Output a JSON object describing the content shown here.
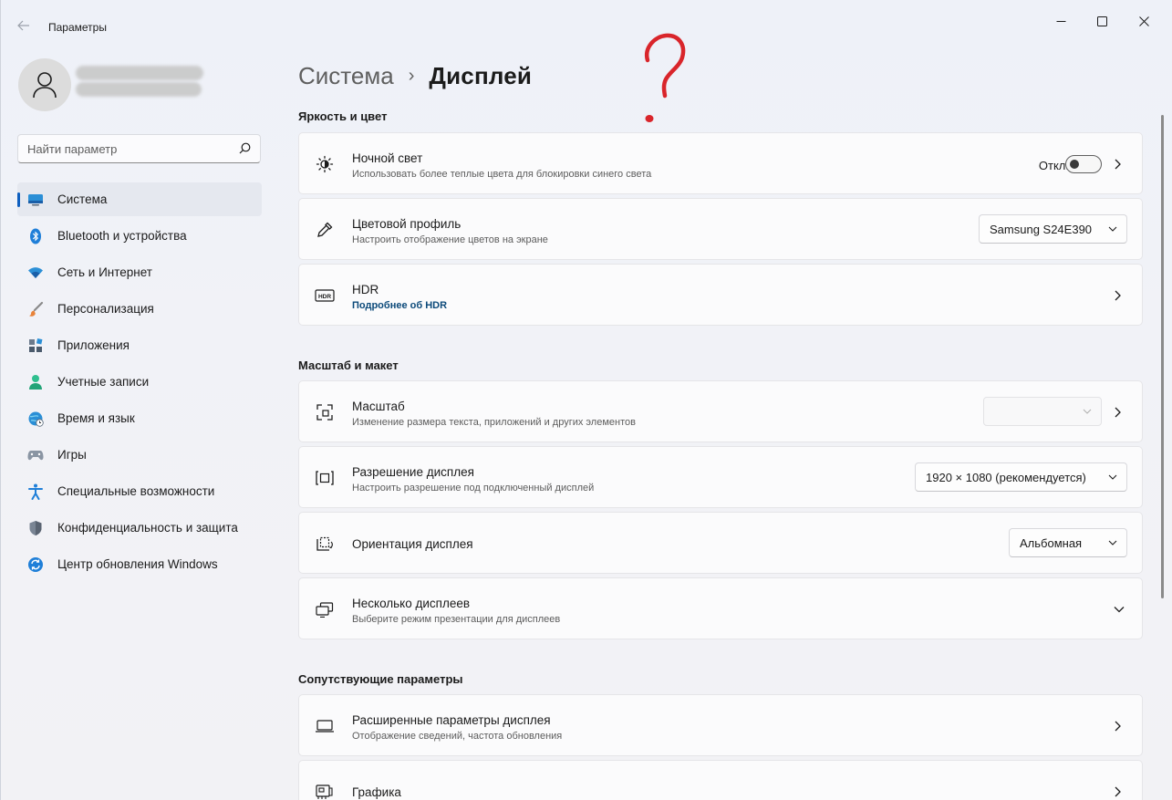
{
  "window": {
    "app_title": "Параметры",
    "back_icon": "back-arrow-icon",
    "controls": [
      "minimize-icon",
      "maximize-icon",
      "close-icon"
    ]
  },
  "profile": {
    "avatar_icon": "user-icon",
    "name_redacted": true
  },
  "search": {
    "placeholder": "Найти параметр",
    "icon": "search-icon"
  },
  "sidebar": {
    "items": [
      {
        "label": "Система",
        "icon": "system-display-icon",
        "active": true
      },
      {
        "label": "Bluetooth и устройства",
        "icon": "bluetooth-icon"
      },
      {
        "label": "Сеть и Интернет",
        "icon": "wifi-icon"
      },
      {
        "label": "Персонализация",
        "icon": "brush-icon"
      },
      {
        "label": "Приложения",
        "icon": "apps-icon"
      },
      {
        "label": "Учетные записи",
        "icon": "account-icon"
      },
      {
        "label": "Время и язык",
        "icon": "globe-clock-icon"
      },
      {
        "label": "Игры",
        "icon": "gamepad-icon"
      },
      {
        "label": "Специальные возможности",
        "icon": "accessibility-icon"
      },
      {
        "label": "Конфиденциальность и защита",
        "icon": "shield-icon"
      },
      {
        "label": "Центр обновления Windows",
        "icon": "update-icon"
      }
    ]
  },
  "breadcrumb": {
    "parent": "Система",
    "separator": "›",
    "current": "Дисплей"
  },
  "sections": {
    "brightness": {
      "heading": "Яркость и цвет",
      "night_light": {
        "title": "Ночной свет",
        "subtitle": "Использовать более теплые цвета для блокировки синего света",
        "state_label": "Откл.",
        "enabled": false,
        "icon": "brightness-icon"
      },
      "color_profile": {
        "title": "Цветовой профиль",
        "subtitle": "Настроить отображение цветов на экране",
        "value": "Samsung S24E390",
        "icon": "eyedropper-icon"
      },
      "hdr": {
        "title": "HDR",
        "link": "Подробнее об HDR",
        "icon": "hdr-icon"
      }
    },
    "scale_layout": {
      "heading": "Масштаб и макет",
      "scale": {
        "title": "Масштаб",
        "subtitle": "Изменение размера текста, приложений и других элементов",
        "value": "",
        "icon": "scale-icon"
      },
      "resolution": {
        "title": "Разрешение дисплея",
        "subtitle": "Настроить разрешение под подключенный дисплей",
        "value": "1920 × 1080 (рекомендуется)",
        "icon": "resolution-icon"
      },
      "orientation": {
        "title": "Ориентация дисплея",
        "value": "Альбомная",
        "icon": "orientation-icon"
      },
      "multiple": {
        "title": "Несколько дисплеев",
        "subtitle": "Выберите режим презентации для дисплеев",
        "icon": "multi-display-icon"
      }
    },
    "related": {
      "heading": "Сопутствующие параметры",
      "advanced": {
        "title": "Расширенные параметры дисплея",
        "subtitle": "Отображение сведений, частота обновления",
        "icon": "monitor-icon"
      },
      "graphics": {
        "title": "Графика",
        "icon": "graphics-icon"
      }
    }
  },
  "annotation": {
    "glyph": "?",
    "color": "#d9252b"
  },
  "colors": {
    "accent": "#0f5fbf",
    "link": "#0c4a7a"
  }
}
